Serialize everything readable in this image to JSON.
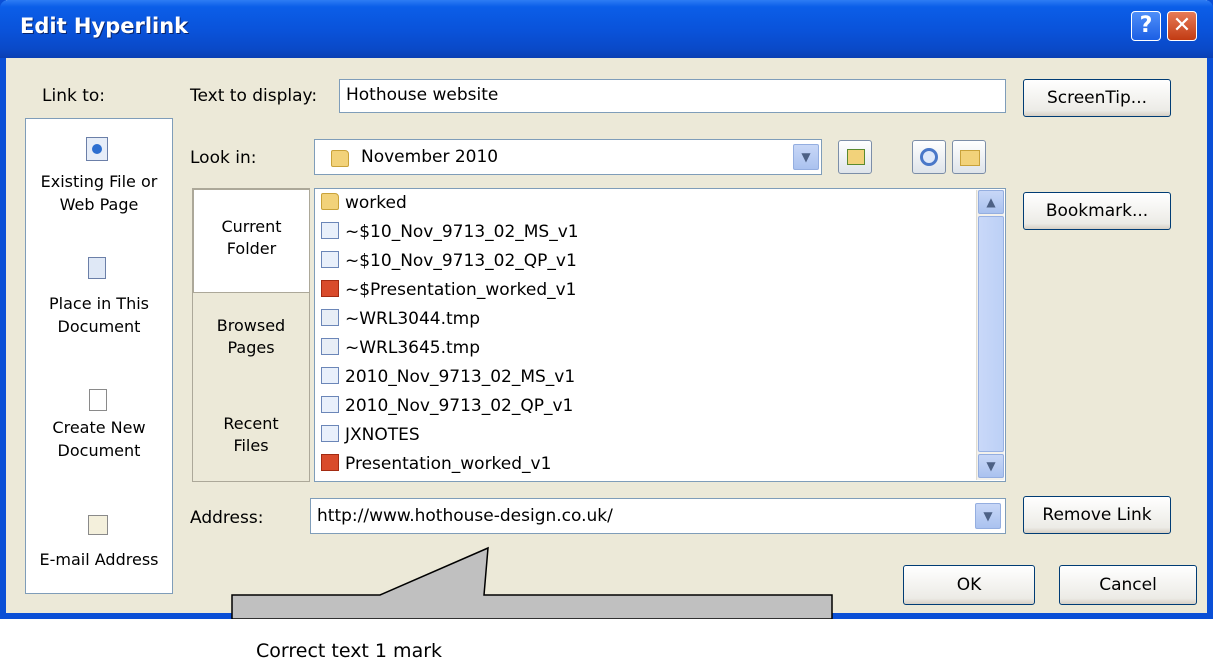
{
  "window": {
    "title": "Edit Hyperlink",
    "help_glyph": "?",
    "close_glyph": "✕"
  },
  "link_to": {
    "label": "Link to:",
    "items": [
      {
        "line1": "Existing File or",
        "line2": "Web Page",
        "icon": "web-page-icon"
      },
      {
        "line1": "Place in This",
        "line2": "Document",
        "icon": "document-place-icon"
      },
      {
        "line1": "Create New",
        "line2": "Document",
        "icon": "new-document-icon"
      },
      {
        "line1": "E-mail Address",
        "line2": "",
        "icon": "email-icon"
      }
    ]
  },
  "text_to_display": {
    "label": "Text to display:",
    "value": "Hothouse website"
  },
  "buttons": {
    "screentip": "ScreenTip...",
    "bookmark": "Bookmark...",
    "remove_link": "Remove Link",
    "ok": "OK",
    "cancel": "Cancel"
  },
  "look_in": {
    "label": "Look in:",
    "value": "November 2010",
    "folder_icon": "folder-icon"
  },
  "tabs": [
    {
      "line1": "Current",
      "line2": "Folder"
    },
    {
      "line1": "Browsed",
      "line2": "Pages"
    },
    {
      "line1": "Recent",
      "line2": "Files"
    }
  ],
  "files": [
    {
      "name": "worked",
      "type": "folder"
    },
    {
      "name": "~$10_Nov_9713_02_MS_v1",
      "type": "word"
    },
    {
      "name": "~$10_Nov_9713_02_QP_v1",
      "type": "word"
    },
    {
      "name": "~$Presentation_worked_v1",
      "type": "ppt"
    },
    {
      "name": "~WRL3044.tmp",
      "type": "tmp"
    },
    {
      "name": "~WRL3645.tmp",
      "type": "tmp"
    },
    {
      "name": "2010_Nov_9713_02_MS_v1",
      "type": "word"
    },
    {
      "name": "2010_Nov_9713_02_QP_v1",
      "type": "word"
    },
    {
      "name": "JXNOTES",
      "type": "word"
    },
    {
      "name": "Presentation_worked_v1",
      "type": "ppt"
    }
  ],
  "address": {
    "label": "Address:",
    "value": "http://www.hothouse-design.co.uk/"
  },
  "callout": {
    "text": "Correct text                                           1 mark"
  },
  "colors": {
    "titlebar": "#0a52d9",
    "dialog_bg": "#ece9d8",
    "callout_fill": "#c0c0c0"
  }
}
